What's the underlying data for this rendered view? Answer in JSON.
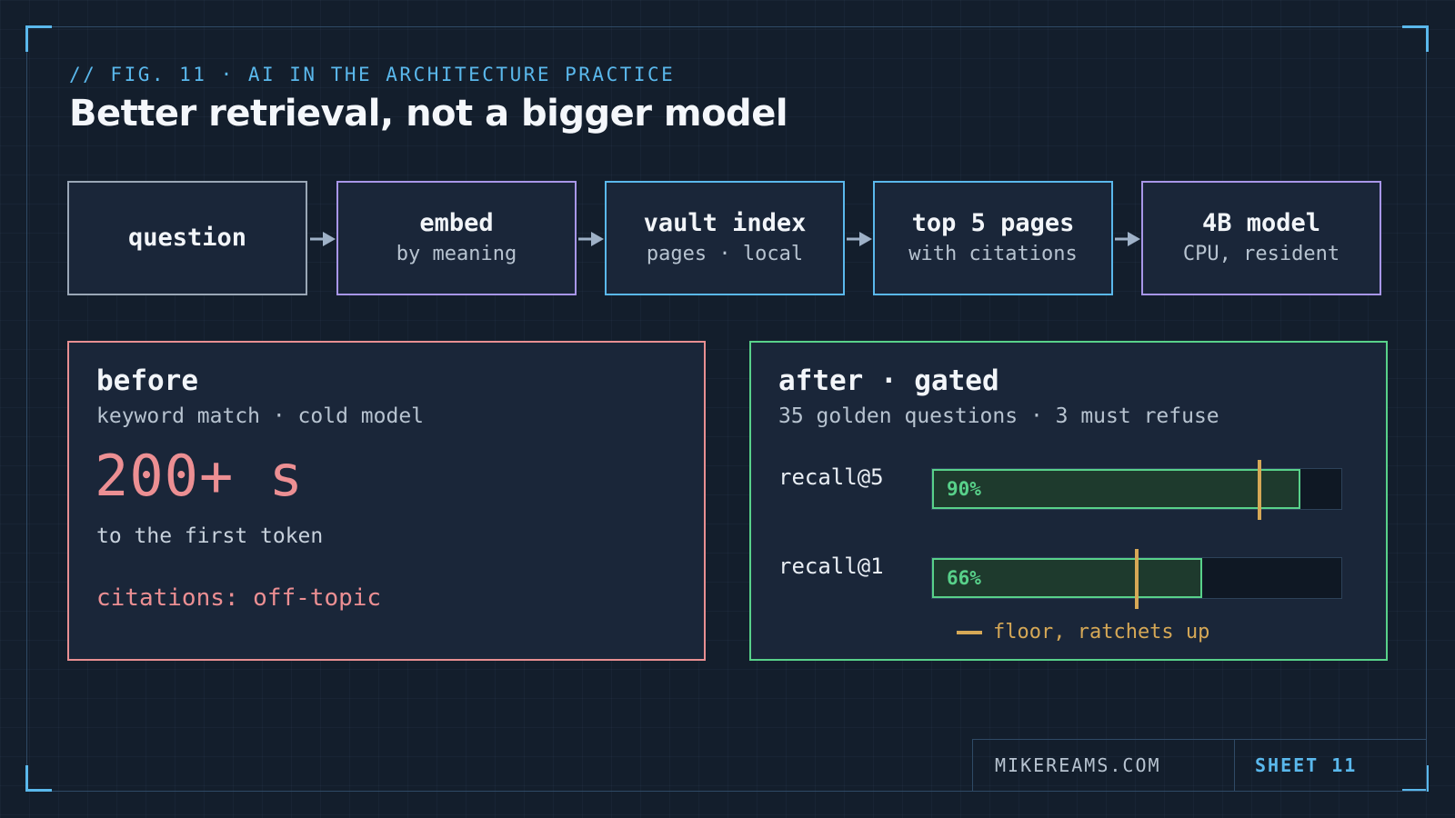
{
  "header": {
    "kicker": "// FIG. 11 · AI IN THE ARCHITECTURE PRACTICE",
    "title": "Better retrieval, not a bigger model"
  },
  "pipeline": [
    {
      "title": "question",
      "subtitle": ""
    },
    {
      "title": "embed",
      "subtitle": "by meaning"
    },
    {
      "title": "vault index",
      "subtitle": "pages · local"
    },
    {
      "title": "top 5 pages",
      "subtitle": "with citations"
    },
    {
      "title": "4B model",
      "subtitle": "CPU, resident"
    }
  ],
  "before": {
    "heading": "before",
    "subheading": "keyword match · cold model",
    "big_value": "200+ s",
    "big_caption": "to the first token",
    "citations": "citations: off-topic"
  },
  "after": {
    "heading": "after · gated",
    "subheading": "35 golden questions · 3 must refuse",
    "metrics": [
      {
        "label": "recall@5",
        "value_text": "90%",
        "value": 0.9,
        "floor": 0.8
      },
      {
        "label": "recall@1",
        "value_text": "66%",
        "value": 0.66,
        "floor": 0.5
      }
    ],
    "legend": "floor, ratchets up"
  },
  "footer": {
    "site": "MIKEREAMS.COM",
    "sheet": "SHEET 11"
  },
  "colors": {
    "background": "#131e2c",
    "accent_cyan": "#5ab8ec",
    "accent_purple": "#a896e8",
    "before_red": "#e88f92",
    "after_green": "#58d18a",
    "floor_gold": "#d6a856"
  }
}
